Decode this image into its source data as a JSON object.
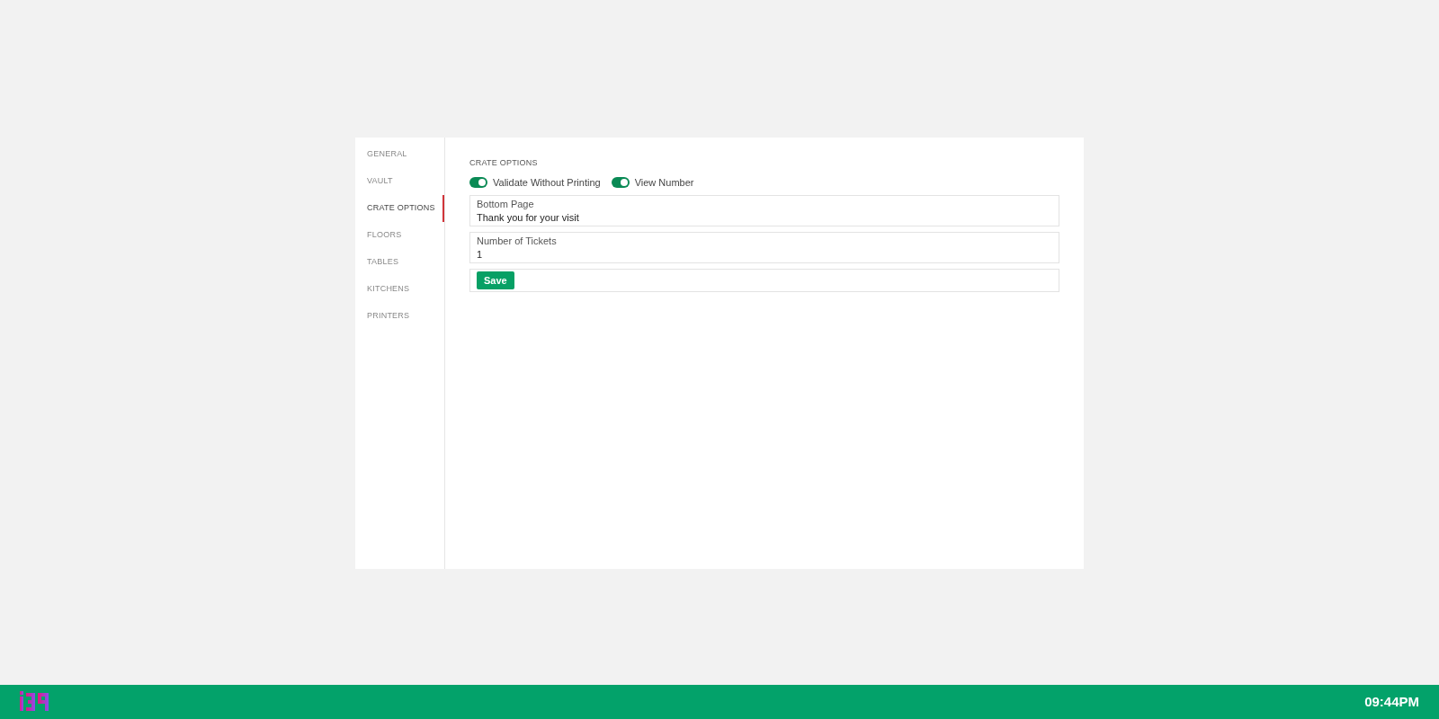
{
  "sidebar": {
    "items": [
      {
        "label": "GENERAL",
        "selected": false
      },
      {
        "label": "VAULT",
        "selected": false
      },
      {
        "label": "CRATE OPTIONS",
        "selected": true
      },
      {
        "label": "FLOORS",
        "selected": false
      },
      {
        "label": "TABLES",
        "selected": false
      },
      {
        "label": "KITCHENS",
        "selected": false
      },
      {
        "label": "PRINTERS",
        "selected": false
      }
    ]
  },
  "section_title": "CRATE OPTIONS",
  "toggles": [
    {
      "label": "Validate Without Printing",
      "on": true
    },
    {
      "label": "View Number",
      "on": true
    }
  ],
  "fields": [
    {
      "label": "Bottom Page",
      "value": "Thank you for your visit"
    },
    {
      "label": "Number of Tickets",
      "value": "1"
    }
  ],
  "save_button": "Save",
  "footer": {
    "time": "09:44PM"
  }
}
